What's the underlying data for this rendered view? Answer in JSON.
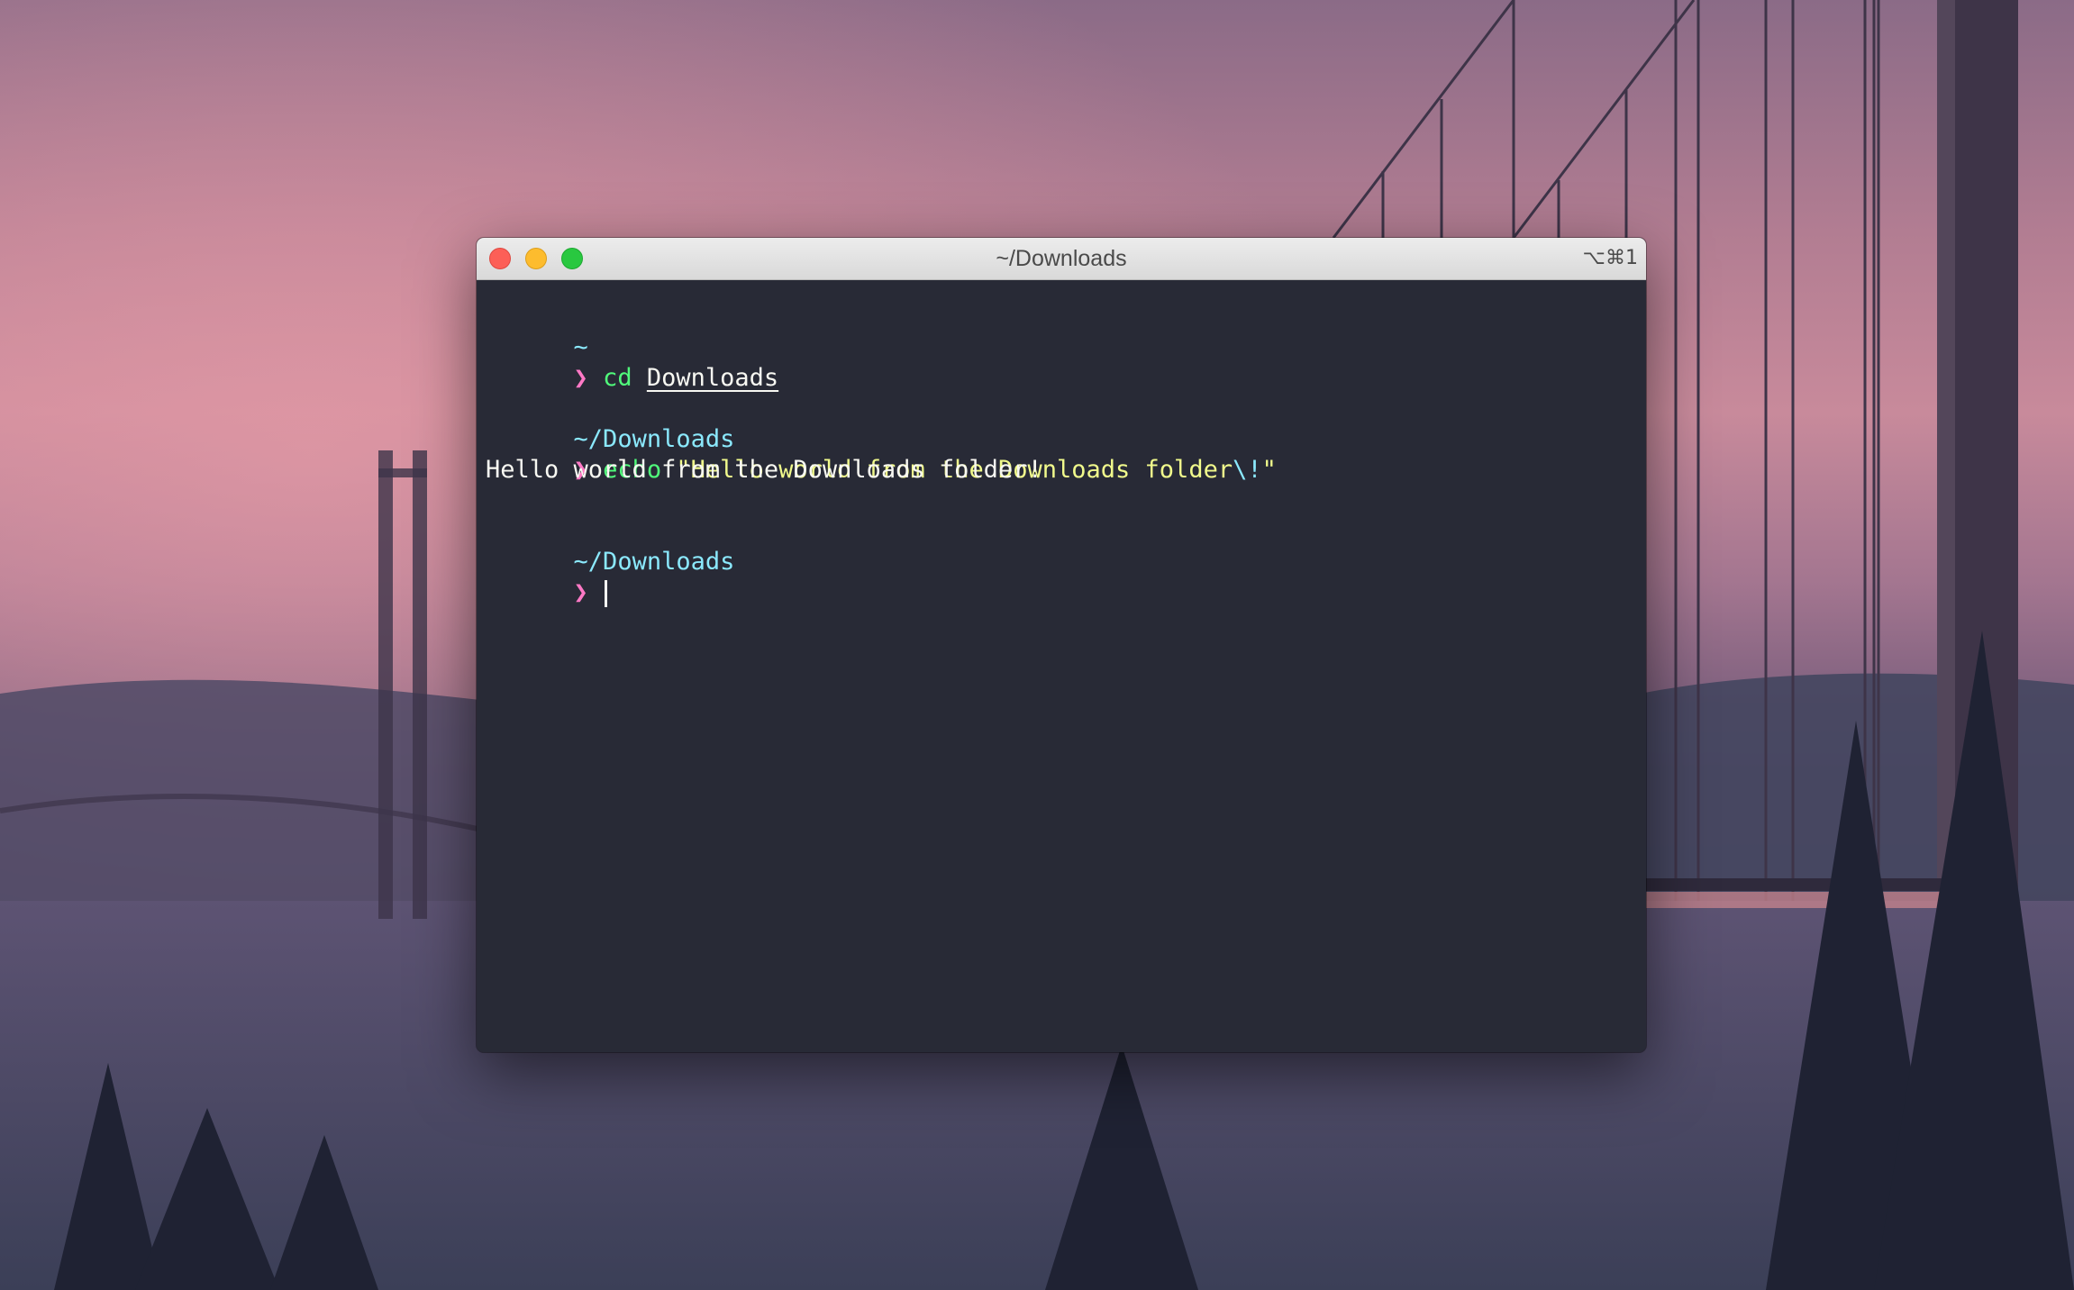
{
  "window": {
    "title": "~/Downloads",
    "shortcut": "⌥⌘1"
  },
  "terminal": {
    "block1": {
      "cwd": "~",
      "prompt": "❯",
      "command": "cd",
      "argument": "Downloads"
    },
    "block2": {
      "cwd": "~/Downloads",
      "prompt": "❯",
      "command": "echo",
      "string_open": "\"Hello world from the Downloads folder",
      "escape": "\\!",
      "string_close": "\"",
      "output": "Hello world from the Downloads folder!"
    },
    "block3": {
      "cwd": "~/Downloads",
      "prompt": "❯"
    }
  },
  "colors": {
    "background": "#282a36",
    "foreground": "#f8f8f2",
    "cwd": "#8be9fd",
    "prompt": "#ff79c6",
    "command": "#50fa7b",
    "string": "#f1fa8c"
  }
}
